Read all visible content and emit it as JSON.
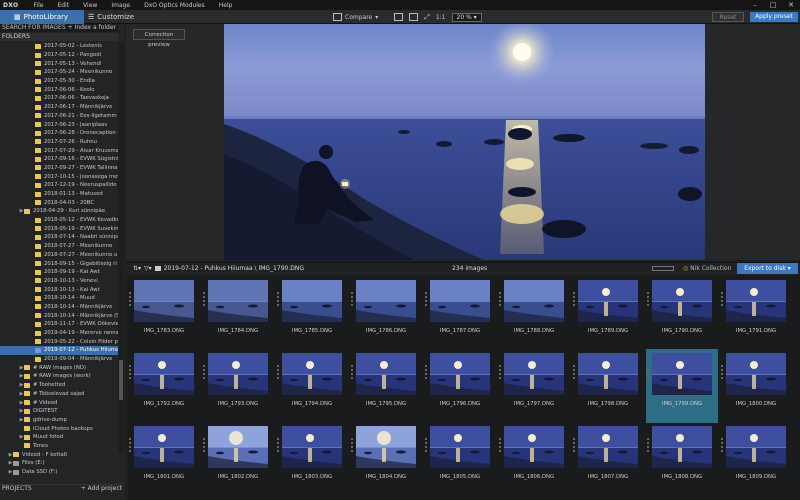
{
  "app": {
    "logo": "DXO",
    "menu": [
      "File",
      "Edit",
      "View",
      "Image",
      "DxO Optics Modules",
      "Help"
    ]
  },
  "toolbar": {
    "tab_library": "PhotoLibrary",
    "tab_customize": "Customize",
    "compare": "Compare",
    "one_to_one": "1:1",
    "zoom": "20 %",
    "reset": "Reset",
    "apply_preset": "Apply preset"
  },
  "sidebar": {
    "search_title": "SEARCH FOR IMAGES",
    "index_folder": "+ Index a folder",
    "folders_title": "FOLDERS",
    "folders": [
      {
        "label": "2017-05-02 - Lestenis",
        "depth": 2,
        "type": "yellow"
      },
      {
        "label": "2017-05-12 - Pangodi",
        "depth": 2,
        "type": "yellow"
      },
      {
        "label": "2017-05-13 - Vehendi",
        "depth": 2,
        "type": "yellow"
      },
      {
        "label": "2017-05-24 - Meenikunno",
        "depth": 2,
        "type": "yellow"
      },
      {
        "label": "2017-05-30 - Endla",
        "depth": 2,
        "type": "yellow"
      },
      {
        "label": "2017-06-06 - Koolo",
        "depth": 2,
        "type": "yellow"
      },
      {
        "label": "2017-06-06 - Taevaskoja",
        "depth": 2,
        "type": "yellow"
      },
      {
        "label": "2017-06-17 - Männikjärve",
        "depth": 2,
        "type": "yellow"
      },
      {
        "label": "2017-06-21 - Ees-Ilgetamm",
        "depth": 2,
        "type": "yellow"
      },
      {
        "label": "2017-06-23 - Jaaniplaav",
        "depth": 2,
        "type": "yellow"
      },
      {
        "label": "2017-06-28 - Dronecaption (",
        "depth": 2,
        "type": "yellow"
      },
      {
        "label": "2017-07-26 - Ruhnu",
        "depth": 2,
        "type": "yellow"
      },
      {
        "label": "2017-07-29 - Äivar Kruusmaa",
        "depth": 2,
        "type": "yellow"
      },
      {
        "label": "2017-09-16 - EVWK Sügisträ",
        "depth": 2,
        "type": "yellow"
      },
      {
        "label": "2017-09-27 - EVWK Tallinna",
        "depth": 2,
        "type": "yellow"
      },
      {
        "label": "2017-10-15 - Joonasega met",
        "depth": 2,
        "type": "yellow"
      },
      {
        "label": "2017-12-19 - Neeruspallide jõ",
        "depth": 2,
        "type": "yellow"
      },
      {
        "label": "2018-01-13 - Matused",
        "depth": 2,
        "type": "yellow"
      },
      {
        "label": "2018-04-03 - 20BC",
        "depth": 2,
        "type": "yellow"
      },
      {
        "label": "2018-04-29 - Kuri sünnipäe",
        "depth": 1,
        "type": "yellow",
        "arrow": "▶"
      },
      {
        "label": "2018-05-12 - EVWK Kevadkr",
        "depth": 2,
        "type": "yellow"
      },
      {
        "label": "2018-05-19 - EVWK Suvekinc",
        "depth": 2,
        "type": "yellow"
      },
      {
        "label": "2018-07-14 - Naabri sünnipä",
        "depth": 2,
        "type": "yellow"
      },
      {
        "label": "2018-07-27 - Meenikunno",
        "depth": 2,
        "type": "yellow"
      },
      {
        "label": "2018-07-27 - Meenikunno u",
        "depth": 2,
        "type": "yellow"
      },
      {
        "label": "2018-09-15 - Gigabitiselg ri",
        "depth": 2,
        "type": "yellow"
      },
      {
        "label": "2018-09-19 - Kai Awt",
        "depth": 2,
        "type": "yellow"
      },
      {
        "label": "2018-10-13 - Venevi",
        "depth": 2,
        "type": "yellow"
      },
      {
        "label": "2018-10-13 - Kai Awt",
        "depth": 2,
        "type": "yellow"
      },
      {
        "label": "2018-10-14 - Muud",
        "depth": 2,
        "type": "yellow"
      },
      {
        "label": "2018-10-14 - Männikjärve",
        "depth": 2,
        "type": "yellow"
      },
      {
        "label": "2018-10-14 - Männikjärve (S",
        "depth": 2,
        "type": "yellow"
      },
      {
        "label": "2018-11-17 - EVWK Öökevie",
        "depth": 2,
        "type": "yellow"
      },
      {
        "label": "2019-04-19 - Mererve rannas",
        "depth": 2,
        "type": "yellow"
      },
      {
        "label": "2019-05-22 - Celvin Pilder p",
        "depth": 2,
        "type": "yellow"
      },
      {
        "label": "2019-07-12 - Puhkus Hiiumaa",
        "depth": 2,
        "type": "blue",
        "selected": true
      },
      {
        "label": "2019-09-04 - Männikjärve",
        "depth": 2,
        "type": "yellow"
      },
      {
        "label": "# RAW images (ND)",
        "depth": 1,
        "type": "yellow",
        "arrow": "▶"
      },
      {
        "label": "# RAW images (work)",
        "depth": 1,
        "type": "yellow",
        "arrow": "▶"
      },
      {
        "label": "# Toohetted",
        "depth": 1,
        "type": "yellow",
        "arrow": "▶"
      },
      {
        "label": "# Tööselevad sajad",
        "depth": 1,
        "type": "yellow",
        "arrow": "▶"
      },
      {
        "label": "# Videod",
        "depth": 1,
        "type": "yellow",
        "arrow": "▶"
      },
      {
        "label": "DIGITEST",
        "depth": 1,
        "type": "yellow",
        "arrow": "▶"
      },
      {
        "label": "gdrive-dump",
        "depth": 1,
        "type": "yellow",
        "arrow": "▶"
      },
      {
        "label": "iCloud Photos backups",
        "depth": 1,
        "type": "yellow"
      },
      {
        "label": "Muud fotod",
        "depth": 1,
        "type": "yellow",
        "arrow": "▶"
      },
      {
        "label": "Tones",
        "depth": 1,
        "type": "yellow"
      },
      {
        "label": "Videod - F kettalt",
        "depth": 0,
        "type": "yellow",
        "arrow": "▶"
      },
      {
        "label": "Files (E:)",
        "depth": 0,
        "type": "grey",
        "arrow": "▶"
      },
      {
        "label": "Data SSD (F:)",
        "depth": 0,
        "type": "grey",
        "arrow": "▶"
      }
    ],
    "projects_title": "PROJECTS",
    "add_project": "+ Add project"
  },
  "viewer": {
    "correction_preview": "Correction preview"
  },
  "filmstrip": {
    "path": "2019-07-12 - Puhkus Hiiumaa \\ IMG_1790.DNG",
    "count": "234 images",
    "nik": "Nik Collection",
    "export": "Export to disk",
    "items": [
      {
        "name": "IMG_1783.DNG",
        "style": "dusk"
      },
      {
        "name": "IMG_1784.DNG",
        "style": "dusk"
      },
      {
        "name": "IMG_1785.DNG",
        "style": "dusk2"
      },
      {
        "name": "IMG_1786.DNG",
        "style": "dusk2"
      },
      {
        "name": "IMG_1787.DNG",
        "style": "dusk2"
      },
      {
        "name": "IMG_1788.DNG",
        "style": "dusk2"
      },
      {
        "name": "IMG_1789.DNG",
        "style": "moon"
      },
      {
        "name": "IMG_1790.DNG",
        "style": "moon"
      },
      {
        "name": "IMG_1791.DNG",
        "style": "moon"
      },
      {
        "name": "IMG_1792.DNG",
        "style": "moon"
      },
      {
        "name": "IMG_1793.DNG",
        "style": "moon"
      },
      {
        "name": "IMG_1794.DNG",
        "style": "moon"
      },
      {
        "name": "IMG_1795.DNG",
        "style": "moon"
      },
      {
        "name": "IMG_1796.DNG",
        "style": "moon"
      },
      {
        "name": "IMG_1797.DNG",
        "style": "moon"
      },
      {
        "name": "IMG_1798.DNG",
        "style": "moon"
      },
      {
        "name": "IMG_1799.DNG",
        "style": "moon",
        "selected": true
      },
      {
        "name": "IMG_1800.DNG",
        "style": "moon"
      },
      {
        "name": "IMG_1801.DNG",
        "style": "moon"
      },
      {
        "name": "IMG_1802.DNG",
        "style": "bright"
      },
      {
        "name": "IMG_1803.DNG",
        "style": "moon"
      },
      {
        "name": "IMG_1804.DNG",
        "style": "bright"
      },
      {
        "name": "IMG_1805.DNG",
        "style": "moon"
      },
      {
        "name": "IMG_1806.DNG",
        "style": "moon"
      },
      {
        "name": "IMG_1807.DNG",
        "style": "moon"
      },
      {
        "name": "IMG_1808.DNG",
        "style": "moon"
      },
      {
        "name": "IMG_1809.DNG",
        "style": "moon"
      }
    ]
  },
  "colors": {
    "accent": "#3b7ac0",
    "selection": "#2e6d86",
    "folder": "#e7c65a"
  }
}
